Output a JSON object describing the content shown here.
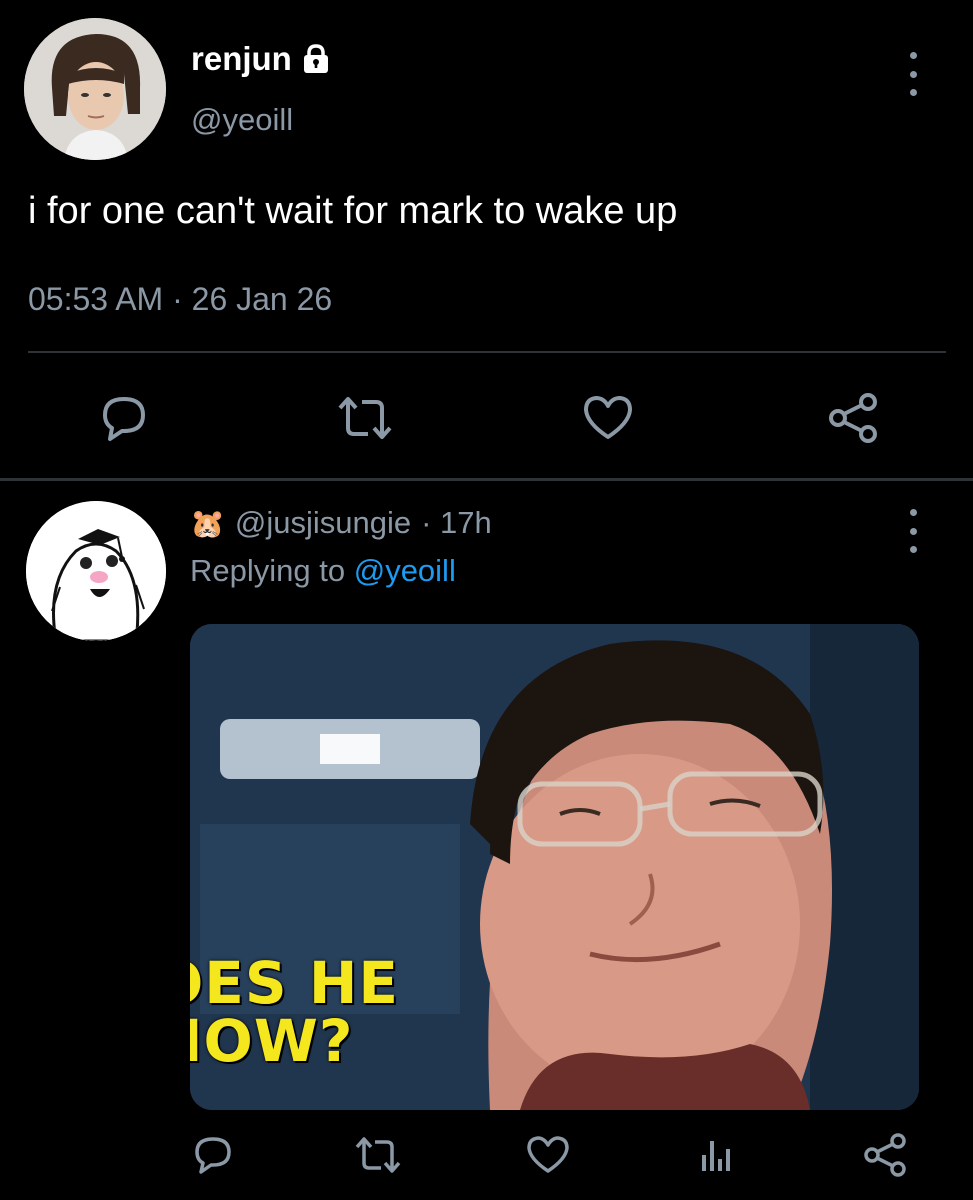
{
  "main_tweet": {
    "display_name": "renjun",
    "handle": "@yeoill",
    "text": "i for one can't wait for mark to wake up",
    "time": "05:53 AM · 26 Jan 26",
    "icons": [
      "lock-icon",
      "more-icon",
      "reply-icon",
      "retweet-icon",
      "like-icon",
      "share-icon"
    ]
  },
  "reply_tweet": {
    "emoji": "🐹",
    "handle": "@jusjisungie",
    "age": "· 17h",
    "replying_prefix": "Replying to",
    "replying_handle": "@yeoill",
    "media_caption_line1": "OES HE",
    "media_caption_line2": "NOW?",
    "icons": [
      "reply-icon",
      "retweet-icon",
      "like-icon",
      "analytics-icon",
      "share-icon",
      "more-icon"
    ]
  },
  "colors": {
    "background": "#000000",
    "text_primary": "#ffffff",
    "text_secondary": "#8b98a5",
    "link": "#1d9bf0",
    "divider": "#2f3336"
  }
}
